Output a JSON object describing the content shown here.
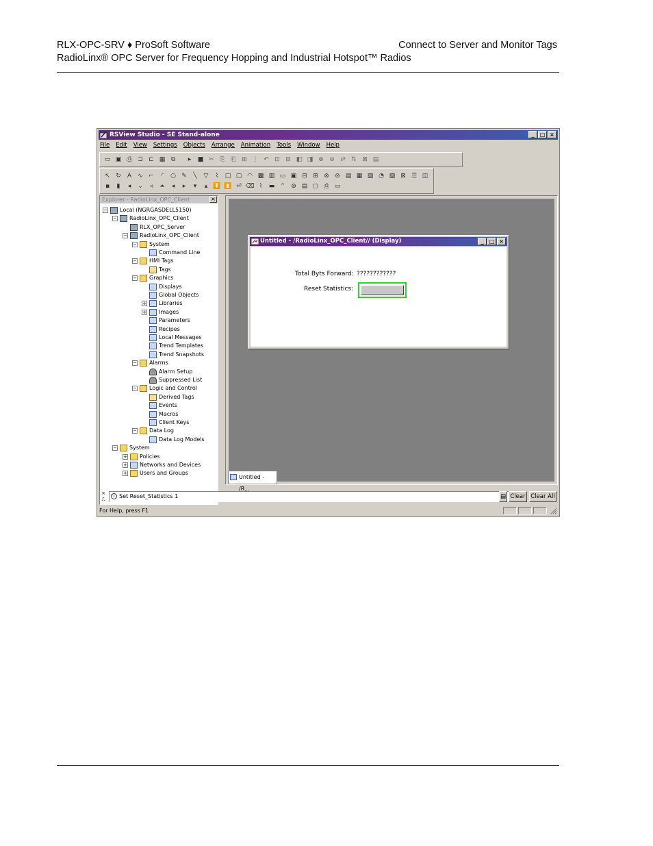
{
  "page_header": {
    "doc_id": "RLX-OPC-SRV ♦ ProSoft Software",
    "subtitle": "RadioLinx® OPC Server for Frequency Hopping and Industrial Hotspot™ Radios",
    "section": "Connect to Server and Monitor Tags"
  },
  "window": {
    "title": "RSView Studio - SE Stand-alone",
    "menu": [
      "File",
      "Edit",
      "View",
      "Settings",
      "Objects",
      "Arrange",
      "Animation",
      "Tools",
      "Window",
      "Help"
    ]
  },
  "explorer": {
    "title": "Explorer - RadioLinx_OPC_Client",
    "items": [
      {
        "label": "Local (NGRGASDELL5150)",
        "icon": "computer-icon"
      },
      {
        "label": "RadioLinx_OPC_Client",
        "icon": "app-icon"
      },
      {
        "label": "RLX_OPC_Server",
        "icon": "server-icon"
      },
      {
        "label": "RadioLinx_OPC_Client",
        "icon": "app-icon"
      },
      {
        "label": "System",
        "icon": "folder-icon"
      },
      {
        "label": "Command Line",
        "icon": "command-line-icon"
      },
      {
        "label": "HMI Tags",
        "icon": "folder-icon"
      },
      {
        "label": "Tags",
        "icon": "tag-icon"
      },
      {
        "label": "Graphics",
        "icon": "folder-icon"
      },
      {
        "label": "Displays",
        "icon": "display-icon"
      },
      {
        "label": "Global Objects",
        "icon": "display-icon"
      },
      {
        "label": "Libraries",
        "icon": "display-icon"
      },
      {
        "label": "Images",
        "icon": "image-icon"
      },
      {
        "label": "Parameters",
        "icon": "parameter-icon"
      },
      {
        "label": "Recipes",
        "icon": "recipe-icon"
      },
      {
        "label": "Local Messages",
        "icon": "message-icon"
      },
      {
        "label": "Trend Templates",
        "icon": "trend-icon"
      },
      {
        "label": "Trend Snapshots",
        "icon": "trend-icon"
      },
      {
        "label": "Alarms",
        "icon": "folder-icon"
      },
      {
        "label": "Alarm Setup",
        "icon": "bell-icon"
      },
      {
        "label": "Suppressed List",
        "icon": "bell-icon"
      },
      {
        "label": "Logic and Control",
        "icon": "folder-icon"
      },
      {
        "label": "Derived Tags",
        "icon": "tag-icon"
      },
      {
        "label": "Events",
        "icon": "clock-icon"
      },
      {
        "label": "Macros",
        "icon": "macro-icon"
      },
      {
        "label": "Client Keys",
        "icon": "key-icon"
      },
      {
        "label": "Data Log",
        "icon": "folder-icon"
      },
      {
        "label": "Data Log Models",
        "icon": "datalog-icon"
      },
      {
        "label": "System",
        "icon": "folder-icon"
      },
      {
        "label": "Policies",
        "icon": "folder-icon"
      },
      {
        "label": "Networks and Devices",
        "icon": "network-icon"
      },
      {
        "label": "Users and Groups",
        "icon": "folder-icon"
      }
    ]
  },
  "display": {
    "title": "Untitled - /RadioLinx_OPC_Client// (Display)",
    "field_label": "Total Byts Forward:",
    "field_value": "????????????",
    "button_label": "Reset Statistics:"
  },
  "tab": {
    "label": "Untitled - /R..."
  },
  "diagnostics": {
    "message": "Set Reset_Statistics 1",
    "clear": "Clear",
    "clear_all": "Clear All"
  },
  "status": {
    "text": "For Help, press F1"
  }
}
